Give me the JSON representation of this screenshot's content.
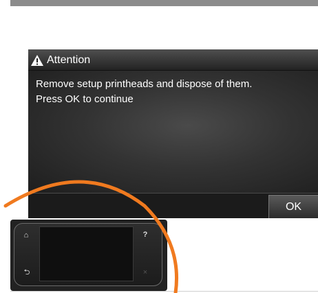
{
  "dialog": {
    "title": "Attention",
    "message_line1": "Remove setup printheads and dispose of them.",
    "message_line2": "Press OK to continue",
    "ok_label": "OK"
  },
  "control_panel": {
    "home_icon_glyph": "⌂",
    "help_icon_glyph": "?",
    "back_icon_glyph": "⮌",
    "close_icon_glyph": "×"
  },
  "colors": {
    "highlight_arc": "#f07a1f",
    "screen_background": "#2b2b2b",
    "top_bar": "#8c8c8c"
  }
}
